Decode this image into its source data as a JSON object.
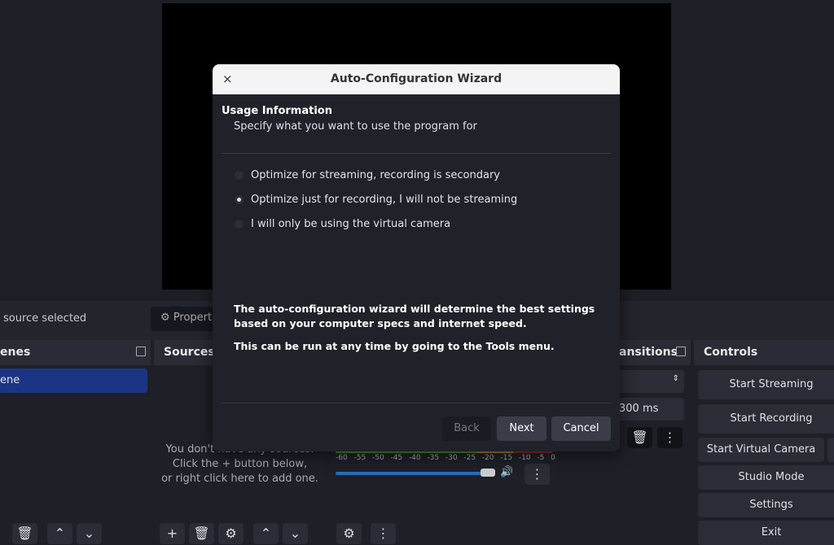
{
  "source_bar": {
    "no_source": "source selected",
    "properties": "⚙ Propert"
  },
  "scenes": {
    "title": "enes",
    "items": [
      "ene"
    ]
  },
  "sources": {
    "title": "Sources",
    "empty": [
      "You don't have any sources.",
      "Click the + button below,",
      "or right click here to add one."
    ]
  },
  "mixer": {
    "ticks": [
      "-60",
      "-55",
      "-50",
      "-45",
      "-40",
      "-35",
      "-30",
      "-25",
      "-20",
      "-15",
      "-10",
      "-5",
      "0"
    ],
    "volume": 0.92
  },
  "transitions": {
    "title": "ansitions",
    "duration": "300 ms"
  },
  "controls": {
    "title": "Controls",
    "buttons": [
      "Start Streaming",
      "Start Recording",
      "Start Virtual Camera",
      "Studio Mode",
      "Settings",
      "Exit"
    ]
  },
  "dialog": {
    "title": "Auto-Configuration Wizard",
    "close": "×",
    "heading": "Usage Information",
    "subheading": "Specify what you want to use the program for",
    "options": [
      {
        "label": "Optimize for streaming, recording is secondary",
        "selected": false
      },
      {
        "label": "Optimize just for recording, I will not be streaming",
        "selected": true
      },
      {
        "label": "I will only be using the virtual camera",
        "selected": false
      }
    ],
    "info1": "The auto-configuration wizard will determine the best settings based on your computer specs and internet speed.",
    "info2": "This can be run at any time by going to the Tools menu.",
    "back": "Back",
    "next": "Next",
    "cancel": "Cancel"
  }
}
